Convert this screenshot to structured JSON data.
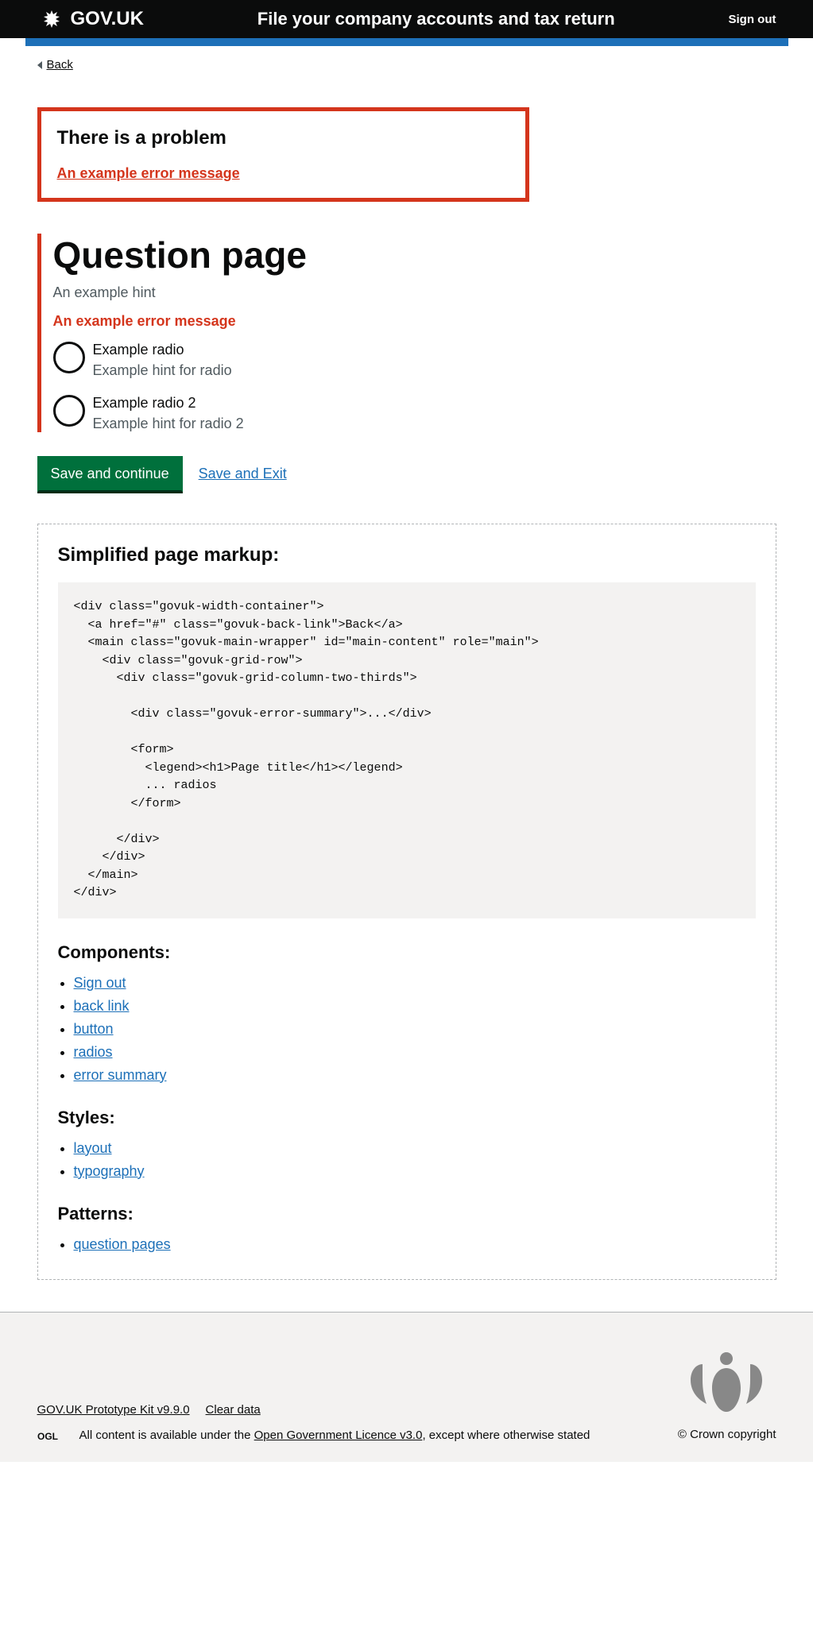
{
  "header": {
    "logo_text": "GOV.UK",
    "service_name": "File your company accounts and tax return",
    "sign_out": "Sign out"
  },
  "back_link": "Back",
  "error_summary": {
    "title": "There is a problem",
    "link_text": "An example error message"
  },
  "question": {
    "title": "Question page",
    "hint": "An example hint",
    "error": "An example error message",
    "radios": [
      {
        "label": "Example radio",
        "hint": "Example hint for radio"
      },
      {
        "label": "Example radio 2",
        "hint": "Example hint for radio 2"
      }
    ]
  },
  "buttons": {
    "save_continue": "Save and continue",
    "save_exit": "Save and Exit"
  },
  "markup_section": {
    "heading": "Simplified page markup:",
    "code": "<div class=\"govuk-width-container\">\n  <a href=\"#\" class=\"govuk-back-link\">Back</a>\n  <main class=\"govuk-main-wrapper\" id=\"main-content\" role=\"main\">\n    <div class=\"govuk-grid-row\">\n      <div class=\"govuk-grid-column-two-thirds\">\n\n        <div class=\"govuk-error-summary\">...</div>\n\n        <form>\n          <legend><h1>Page title</h1></legend>\n          ... radios\n        </form>\n\n      </div>\n    </div>\n  </main>\n</div>",
    "components_heading": "Components:",
    "components": [
      "Sign out",
      "back link",
      "button",
      "radios",
      "error summary"
    ],
    "styles_heading": "Styles:",
    "styles": [
      "layout",
      "typography"
    ],
    "patterns_heading": "Patterns:",
    "patterns": [
      "question pages"
    ]
  },
  "footer": {
    "prototype_kit": "GOV.UK Prototype Kit v9.9.0",
    "clear_data": "Clear data",
    "license_prefix": "All content is available under the ",
    "license_link": "Open Government Licence v3.0",
    "license_suffix": ", except where otherwise stated",
    "copyright": "© Crown copyright"
  }
}
